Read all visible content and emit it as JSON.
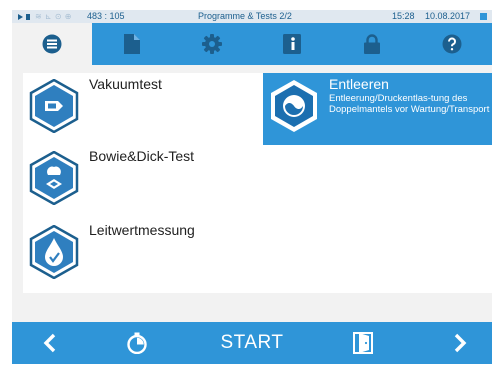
{
  "status_bar": {
    "indicators": "≋ ⊾ ⊙ ⊕",
    "counter": "483 : 105",
    "title": "Programme & Tests  2/2",
    "time": "15:28",
    "date": "10.08.2017"
  },
  "tabs": [
    {
      "icon": "list-icon",
      "active": true
    },
    {
      "icon": "document-icon",
      "active": false
    },
    {
      "icon": "gear-icon",
      "active": false
    },
    {
      "icon": "info-book-icon",
      "active": false
    },
    {
      "icon": "lock-icon",
      "active": false
    },
    {
      "icon": "help-icon",
      "active": false
    }
  ],
  "programs": [
    {
      "title": "Vakuumtest",
      "icon": "vacuum-test-icon",
      "selected": false
    },
    {
      "title": "Bowie&Dick-Test",
      "icon": "bowie-dick-icon",
      "selected": false
    },
    {
      "title": "Leitwertmessung",
      "icon": "conductivity-icon",
      "selected": false
    },
    {
      "title": "Entleeren",
      "description": "Entleerung/Druckentlas-tung des Doppelmantels vor Wartung/Transport",
      "icon": "drain-icon",
      "selected": true
    }
  ],
  "bottom_bar": {
    "prev_icon": "chevron-left-icon",
    "timer_icon": "timer-icon",
    "start_label": "START",
    "door_icon": "door-icon",
    "next_icon": "chevron-right-icon"
  },
  "colors": {
    "accent": "#2f95d8",
    "icon_dark": "#1c5f8e",
    "background": "#f2f2f2"
  }
}
